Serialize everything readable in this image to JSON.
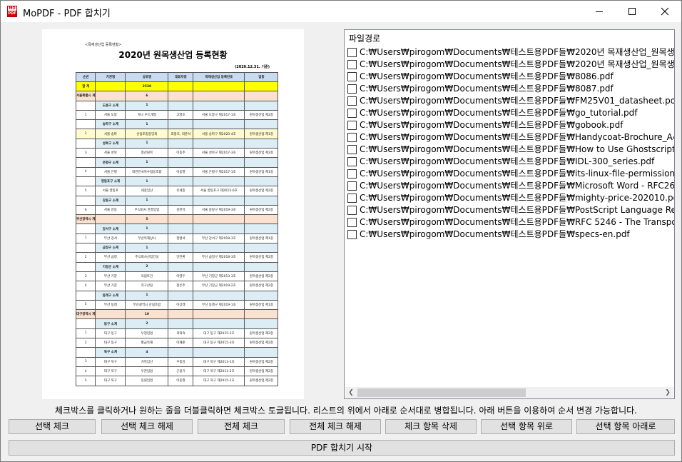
{
  "window": {
    "title": "MoPDF - PDF 합치기",
    "icon_top": "MO",
    "icon_bottom": "PDF",
    "minimize_icon": "minimize-icon",
    "maximize_icon": "maximize-icon",
    "close_icon": "close-icon"
  },
  "preview": {
    "small_title": "<목재생산업 등록현황>",
    "title": "2020년 원목생산업 등록현황",
    "date": "(2020.12.31. 기준)",
    "headers": [
      "순번",
      "기관명",
      "상호명",
      "대표자명",
      "목재생산업 등록번호",
      "업종"
    ],
    "rows": [
      {
        "type": "total",
        "cells": [
          "합 계",
          "",
          "2538",
          "",
          "",
          ""
        ]
      },
      {
        "type": "region",
        "cells": [
          "서울특별시 계",
          "",
          "6",
          "",
          "",
          ""
        ]
      },
      {
        "type": "sub",
        "cells": [
          "",
          "도봉구 소계",
          "1",
          "",
          "",
          ""
        ]
      },
      {
        "type": "data",
        "cells": [
          "1",
          "서울 도봉",
          "하나 우드개발",
          "고영호",
          "서울 도봉구 제2017-1호",
          "원목생산업 제2종"
        ]
      },
      {
        "type": "sub",
        "cells": [
          "",
          "송파구 소계",
          "1",
          "",
          "",
          ""
        ]
      },
      {
        "type": "hl",
        "cells": [
          "2",
          "서울 송파",
          "산림조합중앙회",
          "최창호, 최준석",
          "서울 송파구 제2020-4호",
          "원목생산업 제1종"
        ]
      },
      {
        "type": "sub",
        "cells": [
          "",
          "성북구 소계",
          "1",
          "",
          "",
          ""
        ]
      },
      {
        "type": "data",
        "cells": [
          "3",
          "서울 성북",
          "정산원목",
          "이동주",
          "서울 성북구 제2017-3호",
          "원목생산업 제2종"
        ]
      },
      {
        "type": "sub",
        "cells": [
          "",
          "은평구 소계",
          "1",
          "",
          "",
          ""
        ]
      },
      {
        "type": "data",
        "cells": [
          "4",
          "서울 은평",
          "대한전국목수협동조합",
          "이동열",
          "서울 은평구 제2017-1호",
          "원목생산업 제1종"
        ]
      },
      {
        "type": "sub",
        "cells": [
          "",
          "영등포구 소계",
          "1",
          "",
          "",
          ""
        ]
      },
      {
        "type": "data",
        "cells": [
          "5",
          "서울 영등포",
          "세종임산",
          "유세종",
          "서울 영등포구 제2015-6호",
          "원목생산업 제2종"
        ]
      },
      {
        "type": "sub",
        "cells": [
          "",
          "강동구 소계",
          "1",
          "",
          "",
          ""
        ]
      },
      {
        "type": "data",
        "cells": [
          "6",
          "서울 강동",
          "주식회사 한결임업",
          "김한석",
          "서울 중랑구 제2019-3호",
          "원목생산업 제2종"
        ]
      },
      {
        "type": "region",
        "cells": [
          "부산광역시 계",
          "",
          "5",
          "",
          "",
          ""
        ]
      },
      {
        "type": "sub",
        "cells": [
          "",
          "강서구 소계",
          "1",
          "",
          "",
          ""
        ]
      },
      {
        "type": "data",
        "cells": [
          "1",
          "부산 강서",
          "부산목재상사",
          "정명서",
          "부산 강서구 제2018-3호",
          "원목생산업 제1종"
        ]
      },
      {
        "type": "sub",
        "cells": [
          "",
          "금정구 소계",
          "1",
          "",
          "",
          ""
        ]
      },
      {
        "type": "data",
        "cells": [
          "2",
          "부산 금정",
          "주식회사산업건설",
          "안진환",
          "부산 금정구 제2018-3호",
          "원목생산업 제2종"
        ]
      },
      {
        "type": "sub",
        "cells": [
          "",
          "기장군 소계",
          "2",
          "",
          "",
          ""
        ]
      },
      {
        "type": "data",
        "cells": [
          "3",
          "부산 기장",
          "육림토건",
          "이영두",
          "부산 기장군 제2013-3호",
          "원목생산업 제2종"
        ]
      },
      {
        "type": "data",
        "cells": [
          "4",
          "부산 기장",
          "지구산림",
          "정은주",
          "부산 기장군 제2019-2호",
          "원목생산업 제2종"
        ]
      },
      {
        "type": "sub",
        "cells": [
          "",
          "동래구 소계",
          "1",
          "",
          "",
          ""
        ]
      },
      {
        "type": "data",
        "cells": [
          "5",
          "부산 동래",
          "부산광역시 산림조합",
          "이상래",
          "부산 동래구 제2019-1호",
          "원목생산업 제1종"
        ]
      },
      {
        "type": "region",
        "cells": [
          "대구광역시 계",
          "",
          "10",
          "",
          "",
          ""
        ]
      },
      {
        "type": "sub",
        "cells": [
          "",
          "동구 소계",
          "2",
          "",
          "",
          ""
        ]
      },
      {
        "type": "data",
        "cells": [
          "1",
          "대구 동구",
          "우정임업",
          "곽희숙",
          "대구 동구 제2015-2호",
          "원목생산업 제2종"
        ]
      },
      {
        "type": "data",
        "cells": [
          "2",
          "대구 동구",
          "황금목재",
          "이재준",
          "대구 동구 제2015-3호",
          "원목생산업 제2종"
        ]
      },
      {
        "type": "sub",
        "cells": [
          "",
          "북구 소계",
          "4",
          "",
          "",
          ""
        ]
      },
      {
        "type": "data",
        "cells": [
          "3",
          "대구 북구",
          "거목임산",
          "우종강",
          "대구 북구 제2013-1호",
          "원목생산업 제2종"
        ]
      },
      {
        "type": "data",
        "cells": [
          "4",
          "대구 북구",
          "우관임업",
          "곤용기",
          "대구 북구 제2013-2호",
          "원목생산업 제2종"
        ]
      },
      {
        "type": "data",
        "cells": [
          "5",
          "대구 북구",
          "동원임업",
          "이동열",
          "대구 북구 제2015-1호",
          "원목생산업 제2종"
        ]
      }
    ]
  },
  "filelist": {
    "header": "파일경로",
    "items": [
      "C:₩Users₩pirogom₩Documents₩테스트용PDF들₩2020년 목재생산업_원목생산업 등록현",
      "C:₩Users₩pirogom₩Documents₩테스트용PDF들₩2020년 목재생산업_원목생산업 등록현",
      "C:₩Users₩pirogom₩Documents₩테스트용PDF들₩8086.pdf",
      "C:₩Users₩pirogom₩Documents₩테스트용PDF들₩8087.pdf",
      "C:₩Users₩pirogom₩Documents₩테스트용PDF들₩FM25V01_datasheet.pdf",
      "C:₩Users₩pirogom₩Documents₩테스트용PDF들₩go_tutorial.pdf",
      "C:₩Users₩pirogom₩Documents₩테스트용PDF들₩gobook.pdf",
      "C:₩Users₩pirogom₩Documents₩테스트용PDF들₩Handycoat-Brochure_A4.pdf",
      "C:₩Users₩pirogom₩Documents₩테스트용PDF들₩How to Use Ghostscript.pdf",
      "C:₩Users₩pirogom₩Documents₩테스트용PDF들₩IDL-300_series.pdf",
      "C:₩Users₩pirogom₩Documents₩테스트용PDF들₩its-linux-file-permissions.pdf",
      "C:₩Users₩pirogom₩Documents₩테스트용PDF들₩Microsoft Word - RFC2616.doc.pdf",
      "C:₩Users₩pirogom₩Documents₩테스트용PDF들₩mighty-price-202010.pdf",
      "C:₩Users₩pirogom₩Documents₩테스트용PDF들₩PostScript Language Reference, third",
      "C:₩Users₩pirogom₩Documents₩테스트용PDF들₩RFC 5246 - The Transport Layer Secur",
      "C:₩Users₩pirogom₩Documents₩테스트용PDF들₩specs-en.pdf"
    ],
    "scroll_left_icon": "scroll-left-icon",
    "scroll_right_icon": "scroll-right-icon"
  },
  "hint": "체크박스를 클릭하거나 원하는 줄을 더블클릭하면 체크박스 토글됩니다. 리스트의 위에서 아래로 순서대로 병합됩니다. 아래 버튼을 이용하여 순서 변경 가능합니다.",
  "buttons": {
    "check_selected": "선택 체크",
    "uncheck_selected": "선택 체크 해제",
    "check_all": "전체 체크",
    "uncheck_all": "전체 체크 해제",
    "delete_checked": "체크 항목 삭제",
    "move_up": "선택 항목 위로",
    "move_down": "선택 항목 아래로",
    "start_merge": "PDF 합치기 시작"
  }
}
